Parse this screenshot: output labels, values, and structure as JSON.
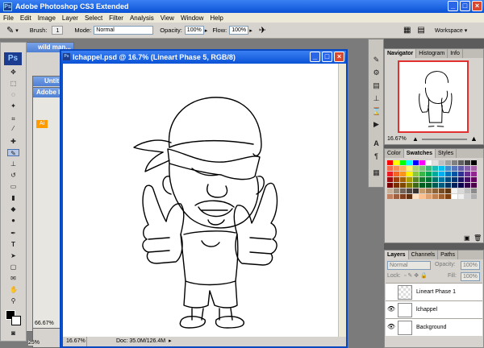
{
  "app": {
    "title": "Adobe Photoshop CS3 Extended",
    "logo": "Ps"
  },
  "menu": [
    "File",
    "Edit",
    "Image",
    "Layer",
    "Select",
    "Filter",
    "Analysis",
    "View",
    "Window",
    "Help"
  ],
  "options": {
    "brush_label": "Brush:",
    "brush_size": "1",
    "mode_label": "Mode:",
    "mode_value": "Normal",
    "opacity_label": "Opacity:",
    "opacity_value": "100%",
    "flow_label": "Flow:",
    "flow_value": "100%",
    "workspace_label": "Workspace"
  },
  "background_docs": {
    "doc1_title": "wild man...",
    "doc2_title": "Untit",
    "doc3_title": "Adobe Illu",
    "doc3_zoom": "66.67%",
    "doc2_zoom": "25%"
  },
  "document": {
    "title": "lchappel.psd @ 16.7% (Lineart Phase 5, RGB/8)",
    "zoom": "16.67%",
    "doc_size": "Doc: 35.0M/126.4M"
  },
  "navigator": {
    "tabs": [
      "Navigator",
      "Histogram",
      "Info"
    ],
    "zoom": "16.67%"
  },
  "color_panel": {
    "tabs": [
      "Color",
      "Swatches",
      "Styles"
    ],
    "swatches": [
      "#ff0000",
      "#ffff00",
      "#00ff00",
      "#00ffff",
      "#0000ff",
      "#ff00ff",
      "#ffffff",
      "#e0e0e0",
      "#c0c0c0",
      "#a0a0a0",
      "#808080",
      "#606060",
      "#404040",
      "#000000",
      "#f26c4f",
      "#f68e56",
      "#fbaf5d",
      "#fff568",
      "#acd372",
      "#7cc576",
      "#3bb878",
      "#1abbb4",
      "#00bff3",
      "#438ccb",
      "#5574b9",
      "#605ca8",
      "#855fa8",
      "#a763a8",
      "#ed1c24",
      "#f26522",
      "#f7941d",
      "#fff200",
      "#8dc63f",
      "#39b54a",
      "#00a651",
      "#00a99d",
      "#00aeef",
      "#0072bc",
      "#0054a6",
      "#2e3192",
      "#662d91",
      "#92278f",
      "#9e0b0f",
      "#a0410d",
      "#a36209",
      "#aba000",
      "#598527",
      "#1a7b30",
      "#007236",
      "#00746b",
      "#0076a3",
      "#004a80",
      "#003471",
      "#1b1464",
      "#440e62",
      "#630460",
      "#790000",
      "#7b2e00",
      "#7d4900",
      "#827b00",
      "#406618",
      "#005e20",
      "#005826",
      "#005952",
      "#005b7f",
      "#003663",
      "#002157",
      "#0d004c",
      "#32004b",
      "#4b0049",
      "#c7b299",
      "#998675",
      "#736357",
      "#534741",
      "#37302d",
      "#c69c6d",
      "#a67c52",
      "#8c6239",
      "#754c24",
      "#603913",
      "#f2f2f2",
      "#d9d9d9",
      "#bfbfbf",
      "#8c8c8c",
      "#c18060",
      "#a06040",
      "#804020",
      "#603010",
      "#ffe0c0",
      "#ffc090",
      "#e0a070",
      "#c08050",
      "#a06030",
      "#804010",
      "#ffffff",
      "#f0f0f0",
      "#d0d0d0",
      "#b0b0b0"
    ]
  },
  "layers": {
    "tabs": [
      "Layers",
      "Channels",
      "Paths"
    ],
    "mode": "Normal",
    "opacity_label": "Opacity:",
    "opacity_value": "100%",
    "lock_label": "Lock:",
    "fill_label": "Fill:",
    "fill_value": "100%",
    "items": [
      {
        "name": "Lineart Phase 1"
      },
      {
        "name": "lchappel"
      },
      {
        "name": "Background"
      }
    ]
  }
}
